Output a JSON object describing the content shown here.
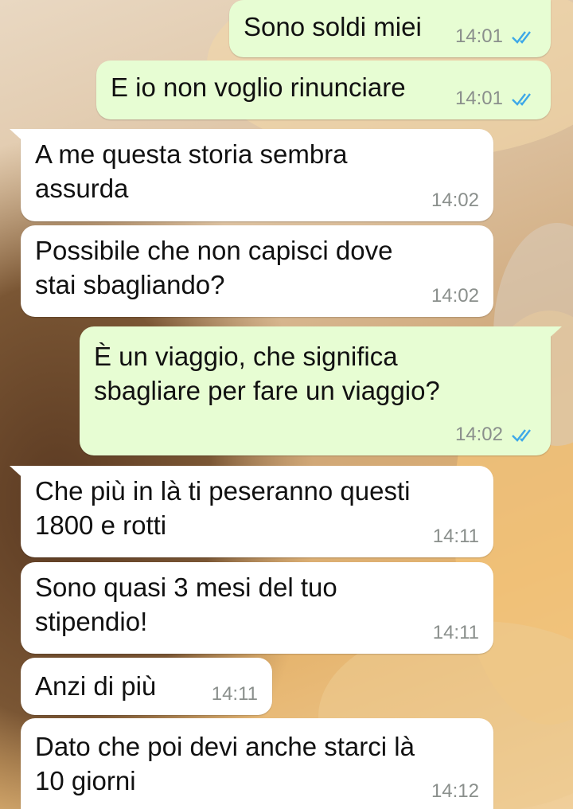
{
  "colors": {
    "outgoing_bubble": "#e7fdd3",
    "incoming_bubble": "#ffffff",
    "read_ticks": "#3ea8e8",
    "timestamp": "#8a8f8c"
  },
  "messages": [
    {
      "direction": "outgoing",
      "text": "Sono soldi miei",
      "time": "14:01",
      "status_icon": "read-double-check-icon"
    },
    {
      "direction": "outgoing",
      "text": "E io non voglio rinunciare",
      "time": "14:01",
      "status_icon": "read-double-check-icon"
    },
    {
      "direction": "incoming",
      "text": "A me questa storia sembra\nassurda",
      "time": "14:02"
    },
    {
      "direction": "incoming",
      "text": "Possibile che non capisci dove\nstai sbagliando?",
      "time": "14:02"
    },
    {
      "direction": "outgoing",
      "text": "È un viaggio, che significa\nsbagliare per fare un viaggio?",
      "time": "14:02",
      "status_icon": "read-double-check-icon"
    },
    {
      "direction": "incoming",
      "text": "Che più in là ti peseranno questi\n1800 e rotti",
      "time": "14:11"
    },
    {
      "direction": "incoming",
      "text": "Sono quasi 3 mesi del tuo\nstipendio!",
      "time": "14:11"
    },
    {
      "direction": "incoming",
      "text": "Anzi di più",
      "time": "14:11"
    },
    {
      "direction": "incoming",
      "text": "Dato che poi devi anche starci là\n10 giorni",
      "time": "14:12"
    }
  ]
}
